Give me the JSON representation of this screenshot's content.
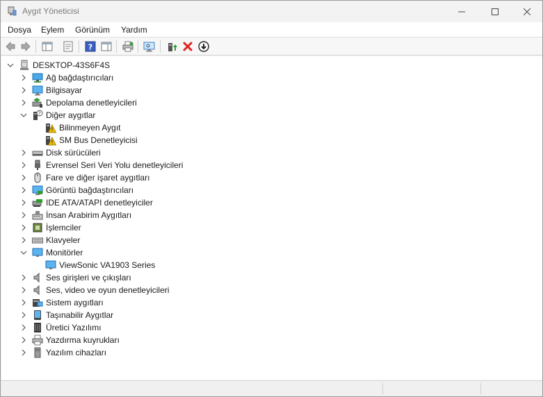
{
  "window": {
    "title": "Aygıt Yöneticisi"
  },
  "menu": [
    "Dosya",
    "Eylem",
    "Görünüm",
    "Yardım"
  ],
  "toolbar": {
    "buttons": [
      "back-icon",
      "forward-icon",
      "show-hide-tree-icon",
      "properties-icon",
      "help-icon",
      "action-pane-icon",
      "update-driver-icon",
      "scan-hardware-icon",
      "enable-device-icon",
      "uninstall-icon",
      "disable-device-icon"
    ]
  },
  "tree": {
    "root": "DESKTOP-43S6F4S",
    "items": [
      {
        "label": "Ağ bağdaştırıcıları",
        "icon": "network-adapter-icon",
        "expanded": false
      },
      {
        "label": "Bilgisayar",
        "icon": "computer-icon",
        "expanded": false
      },
      {
        "label": "Depolama denetleyicileri",
        "icon": "storage-controller-icon",
        "expanded": false
      },
      {
        "label": "Diğer aygıtlar",
        "icon": "other-devices-icon",
        "expanded": true
      },
      {
        "label": "Bilinmeyen Aygıt",
        "icon": "warning-device-icon",
        "child": true
      },
      {
        "label": "SM Bus Denetleyicisi",
        "icon": "warning-device-icon",
        "child": true
      },
      {
        "label": "Disk sürücüleri",
        "icon": "disk-drive-icon",
        "expanded": false
      },
      {
        "label": "Evrensel Seri Veri Yolu denetleyicileri",
        "icon": "usb-icon",
        "expanded": false
      },
      {
        "label": "Fare ve diğer işaret aygıtları",
        "icon": "mouse-icon",
        "expanded": false
      },
      {
        "label": "Görüntü bağdaştırıcıları",
        "icon": "display-adapter-icon",
        "expanded": false
      },
      {
        "label": "IDE ATA/ATAPI denetleyiciler",
        "icon": "ide-controller-icon",
        "expanded": false
      },
      {
        "label": "İnsan Arabirim Aygıtları",
        "icon": "hid-icon",
        "expanded": false
      },
      {
        "label": "İşlemciler",
        "icon": "processor-icon",
        "expanded": false
      },
      {
        "label": "Klavyeler",
        "icon": "keyboard-icon",
        "expanded": false
      },
      {
        "label": "Monitörler",
        "icon": "monitor-icon",
        "expanded": true
      },
      {
        "label": "ViewSonic VA1903 Series",
        "icon": "monitor-icon",
        "child": true
      },
      {
        "label": "Ses girişleri ve çıkışları",
        "icon": "speaker-icon",
        "expanded": false
      },
      {
        "label": "Ses, video ve oyun denetleyicileri",
        "icon": "speaker-icon",
        "expanded": false
      },
      {
        "label": "Sistem aygıtları",
        "icon": "system-devices-icon",
        "expanded": false
      },
      {
        "label": "Taşınabilir Aygıtlar",
        "icon": "portable-device-icon",
        "expanded": false
      },
      {
        "label": "Üretici Yazılımı",
        "icon": "firmware-icon",
        "expanded": false
      },
      {
        "label": "Yazdırma kuyrukları",
        "icon": "printer-icon",
        "expanded": false
      },
      {
        "label": "Yazılım cihazları",
        "icon": "software-device-icon",
        "expanded": false
      }
    ]
  },
  "colors": {
    "accent": "#2a6fc9",
    "warning": "#f2c200",
    "delete": "#e02020"
  }
}
